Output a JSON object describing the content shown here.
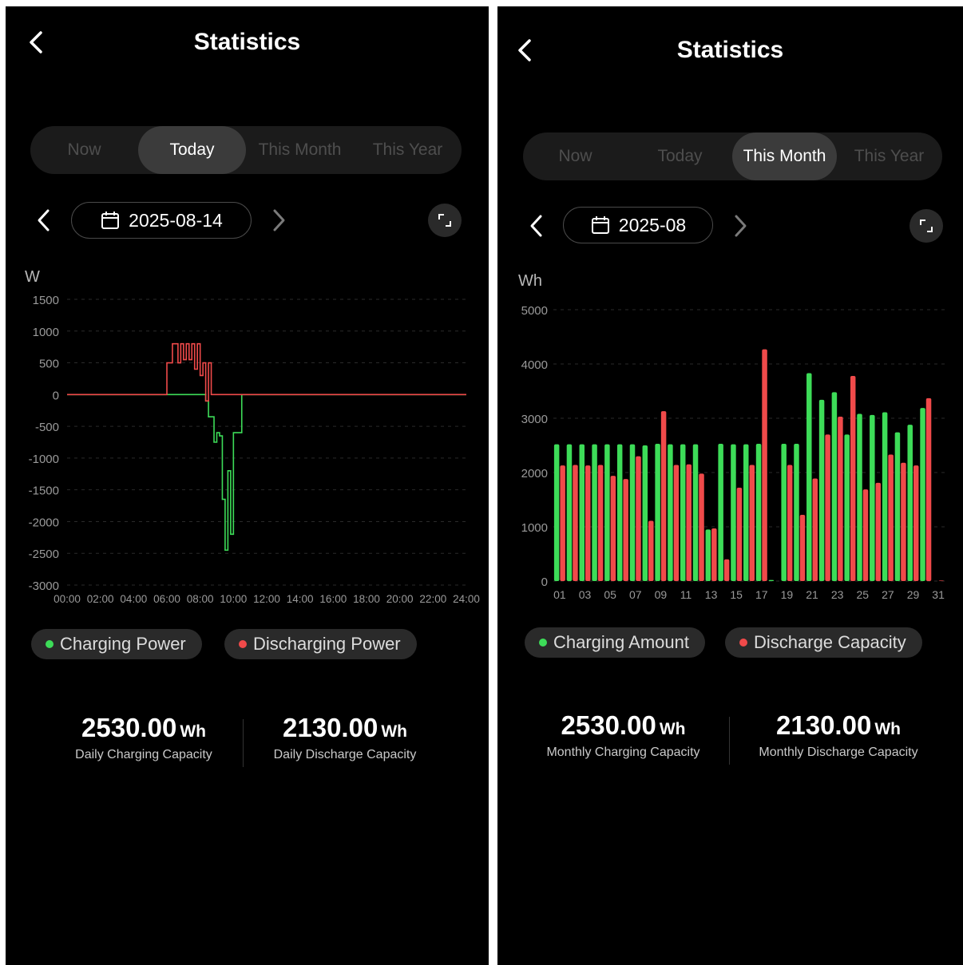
{
  "colors": {
    "charge": "#3ddc58",
    "discharge": "#f04a4a",
    "axis_text": "#9a9a9a"
  },
  "left": {
    "header": {
      "title": "Statistics",
      "back_icon": "chevron-left-icon"
    },
    "tabs": [
      {
        "label": "Now",
        "active": false
      },
      {
        "label": "Today",
        "active": true
      },
      {
        "label": "This Month",
        "active": false
      },
      {
        "label": "This Year",
        "active": false
      }
    ],
    "date_nav": {
      "date": "2025-08-14",
      "prev_icon": "chevron-left-icon",
      "next_icon": "chevron-right-icon",
      "calendar_icon": "calendar-icon",
      "expand_icon": "expand-icon"
    },
    "legend": [
      {
        "label": "Charging Power",
        "color": "#3ddc58"
      },
      {
        "label": "Discharging Power",
        "color": "#f04a4a"
      }
    ],
    "stats": [
      {
        "value": "2530.00",
        "unit": "Wh",
        "caption": "Daily Charging Capacity"
      },
      {
        "value": "2130.00",
        "unit": "Wh",
        "caption": "Daily Discharge Capacity"
      }
    ]
  },
  "right": {
    "header": {
      "title": "Statistics",
      "back_icon": "chevron-left-icon"
    },
    "tabs": [
      {
        "label": "Now",
        "active": false
      },
      {
        "label": "Today",
        "active": false
      },
      {
        "label": "This Month",
        "active": true
      },
      {
        "label": "This Year",
        "active": false
      }
    ],
    "date_nav": {
      "date": "2025-08",
      "prev_icon": "chevron-left-icon",
      "next_icon": "chevron-right-icon",
      "calendar_icon": "calendar-icon",
      "expand_icon": "expand-icon"
    },
    "legend": [
      {
        "label": "Charging Amount",
        "color": "#3ddc58"
      },
      {
        "label": "Discharge Capacity",
        "color": "#f04a4a"
      }
    ],
    "stats": [
      {
        "value": "2530.00",
        "unit": "Wh",
        "caption": "Monthly Charging Capacity"
      },
      {
        "value": "2130.00",
        "unit": "Wh",
        "caption": "Monthly Discharge Capacity"
      }
    ]
  },
  "chart_data": [
    {
      "type": "line",
      "xlabel": "",
      "ylabel": "W",
      "ylim": [
        -3000,
        1500
      ],
      "yticks": [
        1500,
        1000,
        500,
        0,
        -500,
        -1000,
        -1500,
        -2000,
        -2500,
        -3000
      ],
      "xticks": [
        "00:00",
        "02:00",
        "04:00",
        "06:00",
        "08:00",
        "10:00",
        "12:00",
        "14:00",
        "16:00",
        "18:00",
        "20:00",
        "22:00",
        "24:00"
      ],
      "grid": true,
      "legend": "bottom",
      "series": [
        {
          "name": "Charging Power",
          "x": [
            "00:00",
            "06:00",
            "08:10",
            "08:20",
            "08:30",
            "08:40",
            "08:50",
            "09:00",
            "09:10",
            "09:20",
            "09:30",
            "09:40",
            "09:50",
            "10:00",
            "10:10",
            "10:30",
            "24:00"
          ],
          "values": [
            0,
            0,
            0,
            -100,
            -350,
            -350,
            -750,
            -600,
            -650,
            -1650,
            -2450,
            -1200,
            -2200,
            -600,
            -600,
            0,
            0
          ]
        },
        {
          "name": "Discharging Power",
          "x": [
            "00:00",
            "05:50",
            "06:00",
            "06:20",
            "06:30",
            "06:40",
            "06:50",
            "07:00",
            "07:10",
            "07:20",
            "07:30",
            "07:40",
            "07:50",
            "08:00",
            "08:10",
            "08:20",
            "08:30",
            "08:40",
            "24:00"
          ],
          "values": [
            0,
            0,
            500,
            800,
            800,
            500,
            800,
            550,
            800,
            550,
            800,
            400,
            800,
            300,
            500,
            -100,
            500,
            0,
            0
          ]
        }
      ]
    },
    {
      "type": "bar",
      "xlabel": "",
      "ylabel": "Wh",
      "ylim": [
        0,
        5000
      ],
      "yticks": [
        5000,
        4000,
        3000,
        2000,
        1000,
        0
      ],
      "xticks": [
        "01",
        "03",
        "05",
        "07",
        "09",
        "11",
        "13",
        "15",
        "17",
        "19",
        "21",
        "23",
        "25",
        "27",
        "29",
        "31"
      ],
      "grid": true,
      "legend": "bottom",
      "categories": [
        "01",
        "02",
        "03",
        "04",
        "05",
        "06",
        "07",
        "08",
        "09",
        "10",
        "11",
        "12",
        "13",
        "14",
        "15",
        "16",
        "17",
        "18",
        "19",
        "20",
        "21",
        "22",
        "23",
        "24",
        "25",
        "26",
        "27",
        "28",
        "29",
        "30",
        "31"
      ],
      "series": [
        {
          "name": "Charging Amount",
          "values": [
            2520,
            2520,
            2520,
            2520,
            2520,
            2520,
            2520,
            2500,
            2530,
            2520,
            2520,
            2520,
            950,
            2530,
            2520,
            2520,
            2530,
            20,
            2530,
            2530,
            3830,
            3340,
            3480,
            2700,
            3080,
            3060,
            3110,
            2740,
            2880,
            3190,
            0
          ]
        },
        {
          "name": "Discharge Capacity",
          "values": [
            2130,
            2140,
            2130,
            2140,
            1940,
            1880,
            2300,
            1110,
            3130,
            2140,
            2150,
            1980,
            970,
            400,
            1720,
            2140,
            4270,
            0,
            2140,
            1220,
            1890,
            2700,
            3030,
            3780,
            1690,
            1810,
            2330,
            2180,
            2130,
            3370,
            10
          ]
        }
      ]
    }
  ]
}
